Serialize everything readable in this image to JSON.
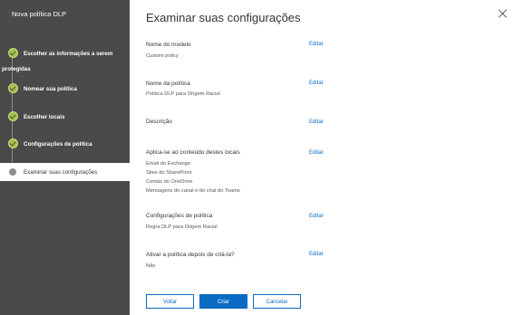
{
  "sidebar": {
    "title": "Nova política DLP",
    "steps": [
      {
        "label_line1": "Escolher as informações a serem",
        "label_line2": "protegidas",
        "status": "completed"
      },
      {
        "label": "Nomear sua política",
        "status": "completed"
      },
      {
        "label": "Escolher locais",
        "status": "completed"
      },
      {
        "label": "Configurações de política",
        "status": "completed"
      },
      {
        "label": "Examinar suas configurações",
        "status": "current"
      }
    ]
  },
  "main": {
    "title": "Examinar suas configurações",
    "edit_label": "Editar",
    "sections": [
      {
        "label": "Nome do modelo",
        "values": [
          "Custom policy"
        ]
      },
      {
        "label": "Nome da política",
        "values": [
          "Política DLP para Origem Racial"
        ]
      },
      {
        "label": "Descrição",
        "values": []
      },
      {
        "label": "Aplica-se ao conteúdo destes locais",
        "values": [
          "Email do Exchange",
          "Sites do SharePoint",
          "Contas do OneDrive",
          "Mensagens do canal e do chat do Teams"
        ]
      },
      {
        "label": "Configurações de política",
        "values": [
          "Regra DLP para Origem Racial"
        ]
      },
      {
        "label": "Ativar a política depois de criá-la?",
        "values": [
          "Não"
        ]
      }
    ]
  },
  "footer": {
    "back_label": "Voltar",
    "create_label": "Criar",
    "cancel_label": "Cancelar"
  },
  "colors": {
    "sidebar_bg": "#4a4a4a",
    "completed": "#a5c14a",
    "accent": "#0a6bc2"
  }
}
